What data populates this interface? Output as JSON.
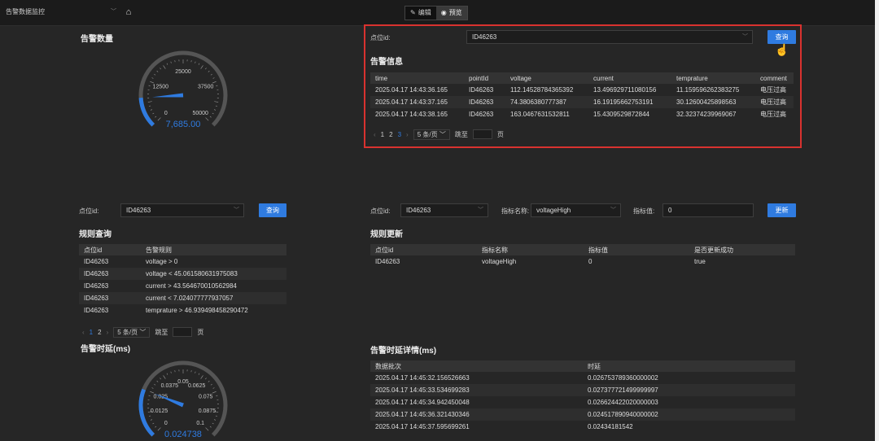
{
  "header": {
    "app_name": "告警数据监控",
    "edit_label": "编辑",
    "preview_label": "预览"
  },
  "alarm_count": {
    "title": "告警数量",
    "gauge": {
      "min": 0,
      "max": 50000,
      "value": 7685,
      "value_text": "7,685.00",
      "ticks": [
        "0",
        "12500",
        "25000",
        "37500",
        "50000"
      ]
    }
  },
  "alarm_info": {
    "point_label": "点位id:",
    "point_value": "ID46263",
    "query_label": "查询",
    "title": "告警信息",
    "columns": [
      "time",
      "pointId",
      "voltage",
      "current",
      "temprature",
      "comment"
    ],
    "rows": [
      [
        "2025.04.17 14:43:36.165",
        "ID46263",
        "112.14528784365392",
        "13.496929711080156",
        "11.159596262383275",
        "电压过高"
      ],
      [
        "2025.04.17 14:43:37.165",
        "ID46263",
        "74.3806380777387",
        "16.19195662753191",
        "30.12600425898563",
        "电压过高"
      ],
      [
        "2025.04.17 14:43:38.165",
        "ID46263",
        "163.0467631532811",
        "15.4309529872844",
        "32.32374239969067",
        "电压过高"
      ]
    ],
    "pager": {
      "pages": [
        "1",
        "2",
        "3"
      ],
      "current": "3",
      "size": "5 条/页",
      "jump": "跳至",
      "page_unit": "页"
    }
  },
  "rule_query": {
    "point_label": "点位id:",
    "point_value": "ID46263",
    "query_label": "查询",
    "title": "规则查询",
    "columns": [
      "点位id",
      "告警规则"
    ],
    "rows": [
      [
        "ID46263",
        "voltage > 0"
      ],
      [
        "ID46263",
        "voltage < 45.061580631975083"
      ],
      [
        "ID46263",
        "current > 43.564670010562984"
      ],
      [
        "ID46263",
        "current < 7.024077777937057"
      ],
      [
        "ID46263",
        "temprature > 46.939498458290472"
      ]
    ],
    "pager": {
      "pages": [
        "1",
        "2"
      ],
      "current": "1",
      "size": "5 条/页",
      "jump": "跳至",
      "page_unit": "页"
    }
  },
  "rule_update": {
    "point_label": "点位id:",
    "point_value": "ID46263",
    "metric_name_label": "指标名称:",
    "metric_name_value": "voltageHigh",
    "metric_value_label": "指标值:",
    "metric_value": "0",
    "update_label": "更新",
    "title": "规则更新",
    "columns": [
      "点位id",
      "指标名称",
      "指标值",
      "是否更新成功"
    ],
    "rows": [
      [
        "ID46263",
        "voltageHigh",
        "0",
        "true"
      ]
    ]
  },
  "alarm_latency": {
    "title": "告警时延(ms)",
    "gauge": {
      "min": 0,
      "max": 0.1,
      "value": 0.024738,
      "value_text": "0.024738",
      "ticks": [
        "0",
        "0.0125",
        "0.025",
        "0.0375",
        "0.05",
        "0.0625",
        "0.075",
        "0.0875",
        "0.1"
      ]
    }
  },
  "latency_detail": {
    "title": "告警时延详情(ms)",
    "columns": [
      "数据批次",
      "时延"
    ],
    "rows": [
      [
        "2025.04.17 14:45:32.156526663",
        "0.026753789360000002"
      ],
      [
        "2025.04.17 14:45:33.534699283",
        "0.027377721499999997"
      ],
      [
        "2025.04.17 14:45:34.942450048",
        "0.026624422020000003"
      ],
      [
        "2025.04.17 14:45:36.321430346",
        "0.024517890940000002"
      ],
      [
        "2025.04.17 14:45:37.595699261",
        "0.02434181542"
      ]
    ]
  },
  "colors": {
    "accent": "#2f7be0",
    "highlight": "#d9322f",
    "background": "#262626"
  }
}
